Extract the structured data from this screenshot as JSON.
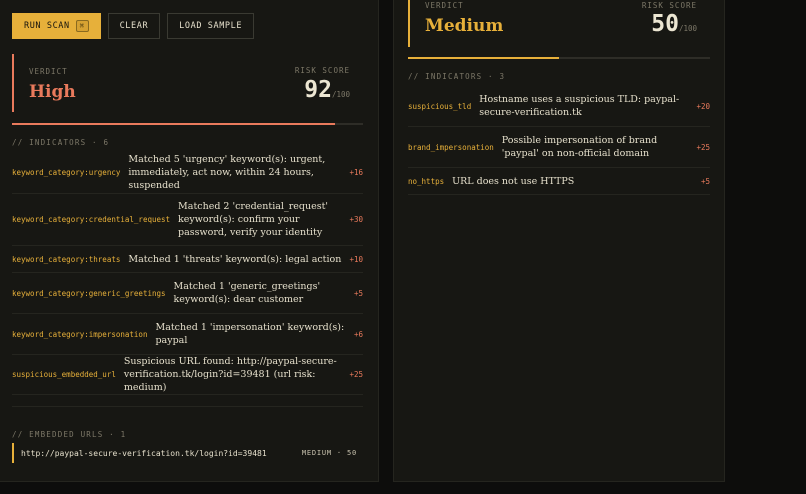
{
  "toolbar": {
    "run_scan_label": "RUN SCAN",
    "run_scan_shortcut": "⌘",
    "clear_label": "CLEAR",
    "load_sample_label": "LOAD SAMPLE"
  },
  "text_scan": {
    "verdict_label": "VERDICT",
    "verdict_value": "High",
    "risk_label": "RISK SCORE",
    "score": "92",
    "score_max": "/100",
    "score_fraction": 0.92,
    "indicators_heading": "// INDICATORS · 6",
    "indicators": [
      {
        "key": "keyword_category:urgency",
        "desc": "Matched 5 'urgency' keyword(s): urgent, immediately, act now, within 24 hours, suspended",
        "score": "+16"
      },
      {
        "key": "keyword_category:credential_request",
        "desc": "Matched 2 'credential_request' keyword(s): confirm your password, verify your identity",
        "score": "+30"
      },
      {
        "key": "keyword_category:threats",
        "desc": "Matched 1 'threats' keyword(s): legal action",
        "score": "+10"
      },
      {
        "key": "keyword_category:generic_greetings",
        "desc": "Matched 1 'generic_greetings' keyword(s): dear customer",
        "score": "+5"
      },
      {
        "key": "keyword_category:impersonation",
        "desc": "Matched 1 'impersonation' keyword(s): paypal",
        "score": "+6"
      },
      {
        "key": "suspicious_embedded_url",
        "desc": "Suspicious URL found: http://paypal-secure-verification.tk/login?id=39481 (url risk: medium)",
        "score": "+25"
      }
    ],
    "embedded_heading": "// EMBEDDED URLS · 1",
    "embedded_urls": [
      {
        "url": "http://paypal-secure-verification.tk/login?id=39481",
        "risk": "MEDIUM · 50"
      }
    ]
  },
  "url_scan": {
    "verdict_label": "VERDICT",
    "verdict_value": "Medium",
    "risk_label": "RISK SCORE",
    "score": "50",
    "score_max": "/100",
    "score_fraction": 0.5,
    "indicators_heading": "// INDICATORS · 3",
    "indicators": [
      {
        "key": "suspicious_tld",
        "desc": "Hostname uses a suspicious TLD: paypal-secure-verification.tk",
        "score": "+20"
      },
      {
        "key": "brand_impersonation",
        "desc": "Possible impersonation of brand 'paypal' on non-official domain",
        "score": "+25"
      },
      {
        "key": "no_https",
        "desc": "URL does not use HTTPS",
        "score": "+5"
      }
    ]
  },
  "colors": {
    "accent": "#e7b03a",
    "high": "#e97a5c",
    "medium": "#e7b03a",
    "panel": "#171713",
    "background": "#0d0d0c"
  }
}
